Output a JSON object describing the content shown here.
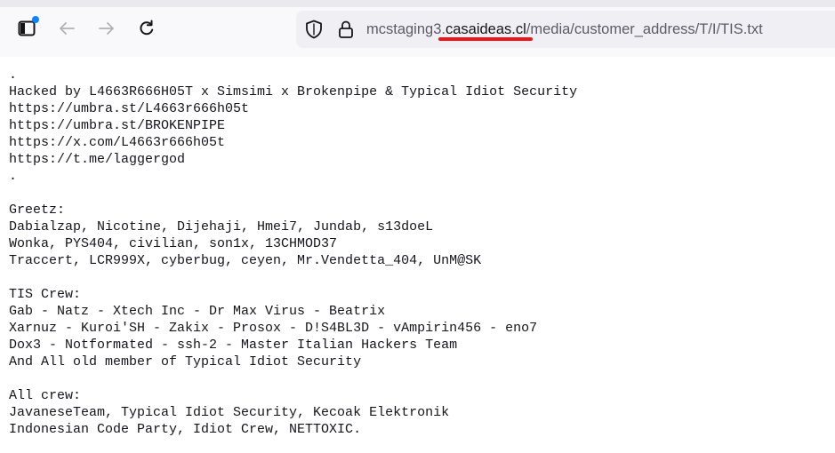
{
  "browser": {
    "url_prefix": "mcstaging3.",
    "url_domain": "casaideas.cl",
    "url_path": "/media/customer_address/T/I/TIS.txt",
    "icons": {
      "sidebar": "sidebar-icon",
      "back": "arrow-left-icon",
      "forward": "arrow-right-icon",
      "reload": "reload-icon",
      "tracking": "shield-icon",
      "security": "lock-icon"
    },
    "annotation_color": "#e8171b"
  },
  "document": {
    "lines": [
      ".",
      "Hacked by L4663R666H05T x Simsimi x Brokenpipe & Typical Idiot Security",
      "https://umbra.st/L4663r666h05t",
      "https://umbra.st/BROKENPIPE",
      "https://x.com/L4663r666h05t",
      "https://t.me/laggergod",
      ".",
      "",
      "Greetz:",
      "Dabialzap, Nicotine, Dijehaji, Hmei7, Jundab, s13doeL",
      "Wonka, PYS404, civilian, son1x, 13CHMOD37",
      "Traccert, LCR999X, cyberbug, ceyen, Mr.Vendetta_404, UnM@SK",
      "",
      "TIS Crew:",
      "Gab - Natz - Xtech Inc - Dr Max Virus - Beatrix",
      "Xarnuz - Kuroi'SH - Zakix - Prosox - D!S4BL3D - vAmpirin456 - eno7",
      "Dox3 - Notformated - ssh-2 - Master Italian Hackers Team",
      "And All old member of Typical Idiot Security",
      "",
      "All crew:",
      "JavaneseTeam, Typical Idiot Security, Kecoak Elektronik",
      "Indonesian Code Party, Idiot Crew, NETTOXIC."
    ]
  }
}
